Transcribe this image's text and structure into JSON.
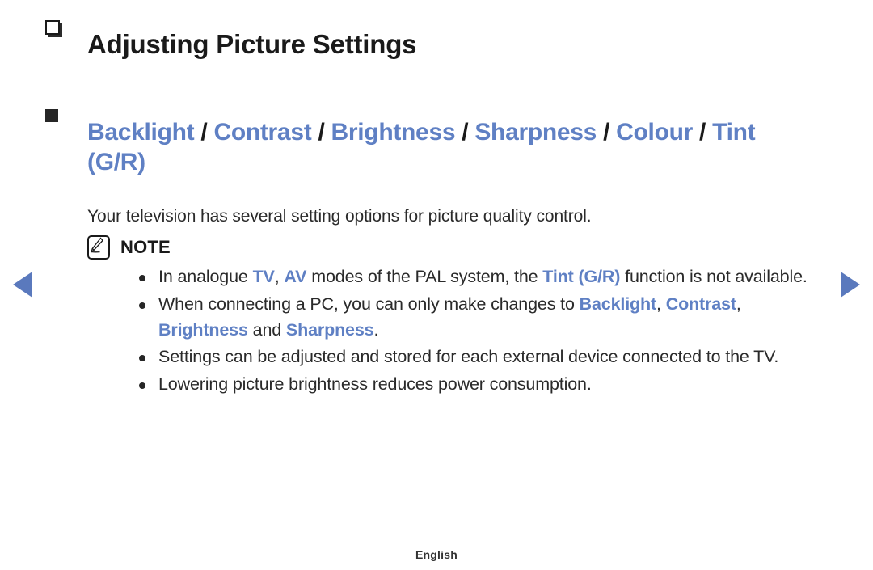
{
  "colors": {
    "accent_blue": "#5f80c4",
    "nav_arrow_blue": "#5a79bd",
    "text_black": "#1a1a1a",
    "body_gray": "#2a2a2a",
    "background": "#ffffff"
  },
  "nav": {
    "prev_label": "◀",
    "next_label": "▶",
    "prev_name": "previous-page-arrow",
    "next_name": "next-page-arrow"
  },
  "page": {
    "title": "Adjusting Picture Settings",
    "title_icon": "square-3d-icon",
    "section": {
      "icon": "filled-square-icon",
      "parts": [
        {
          "text": "Backlight",
          "style": "keyword"
        },
        {
          "text": " / ",
          "style": "separator"
        },
        {
          "text": "Contrast",
          "style": "keyword"
        },
        {
          "text": " / ",
          "style": "separator"
        },
        {
          "text": "Brightness",
          "style": "keyword"
        },
        {
          "text": " / ",
          "style": "separator"
        },
        {
          "text": "Sharpness",
          "style": "keyword"
        },
        {
          "text": " / ",
          "style": "separator"
        },
        {
          "text": "Colour",
          "style": "keyword"
        },
        {
          "text": " / ",
          "style": "separator"
        },
        {
          "text": "Tint (G/R)",
          "style": "keyword"
        }
      ],
      "plain_text": "Backlight / Contrast / Brightness / Sharpness / Colour / Tint (G/R)"
    },
    "body_text": "Your television has several setting options for picture quality control.",
    "note": {
      "icon": "note-pencil-icon",
      "label": "NOTE",
      "items": [
        {
          "plain_text": "In analogue TV, AV modes of the PAL system, the Tint (G/R) function is not available.",
          "segments": [
            {
              "text": "In analogue ",
              "style": "plain"
            },
            {
              "text": "TV",
              "style": "keyword-bold"
            },
            {
              "text": ", ",
              "style": "plain"
            },
            {
              "text": "AV",
              "style": "keyword-bold"
            },
            {
              "text": " modes of the PAL system, the ",
              "style": "plain"
            },
            {
              "text": "Tint (G/R)",
              "style": "keyword-bold"
            },
            {
              "text": " function is not available.",
              "style": "plain"
            }
          ]
        },
        {
          "plain_text": "When connecting a PC, you can only make changes to Backlight, Contrast, Brightness and Sharpness.",
          "segments": [
            {
              "text": "When connecting a PC, you can only make changes to ",
              "style": "plain"
            },
            {
              "text": "Backlight",
              "style": "keyword-bold"
            },
            {
              "text": ", ",
              "style": "plain"
            },
            {
              "text": "Contrast",
              "style": "keyword-bold"
            },
            {
              "text": ", ",
              "style": "plain"
            },
            {
              "text": "Brightness",
              "style": "keyword-bold"
            },
            {
              "text": " and ",
              "style": "plain"
            },
            {
              "text": "Sharpness",
              "style": "keyword-bold"
            },
            {
              "text": ".",
              "style": "plain"
            }
          ]
        },
        {
          "plain_text": "Settings can be adjusted and stored for each external device connected to the TV.",
          "segments": [
            {
              "text": "Settings can be adjusted and stored for each external device connected to the TV.",
              "style": "plain"
            }
          ]
        },
        {
          "plain_text": "Lowering picture brightness reduces power consumption.",
          "segments": [
            {
              "text": "Lowering picture brightness reduces power consumption.",
              "style": "plain"
            }
          ]
        }
      ]
    }
  },
  "footer": {
    "language": "English"
  }
}
